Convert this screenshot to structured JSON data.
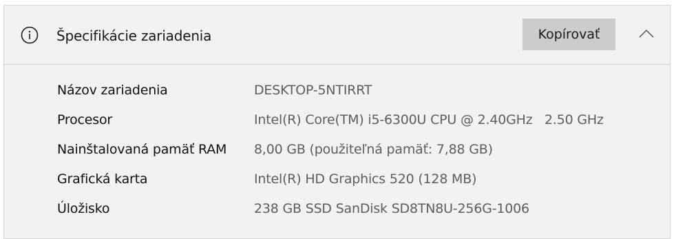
{
  "header": {
    "icon": "info-icon",
    "title": "Špecifikácie zariadenia",
    "copy_label": "Kopírovať",
    "collapse_icon": "chevron-up-icon"
  },
  "specs": [
    {
      "label": "Názov zariadenia",
      "value": "DESKTOP-5NTIRRT"
    },
    {
      "label": "Procesor",
      "value": "Intel(R) Core(TM) i5-6300U CPU @ 2.40GHz   2.50 GHz"
    },
    {
      "label": "Nainštalovaná pamäť RAM",
      "value": "8,00 GB (použiteľná pamäť: 7,88 GB)"
    },
    {
      "label": "Grafická karta",
      "value": "Intel(R) HD Graphics 520 (128 MB)"
    },
    {
      "label": "Úložisko",
      "value": "238 GB SSD SanDisk SD8TN8U-256G-1006"
    }
  ],
  "colors": {
    "panel_background": "#f2f2f2",
    "button_background": "#cccccc",
    "label_text": "#111111",
    "value_text": "#5e5e5e"
  }
}
